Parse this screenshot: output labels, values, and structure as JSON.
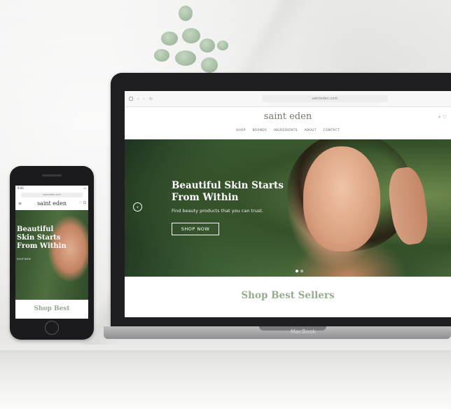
{
  "laptop": {
    "brand": "MacBook",
    "url": "sainteden.com",
    "site": {
      "logo": "saint eden",
      "nav": [
        "SHOP",
        "BRANDS",
        "INGREDIENTS",
        "ABOUT",
        "CONTACT"
      ],
      "hero": {
        "title_line1": "Beautiful Skin Starts",
        "title_line2": "From Within",
        "subtitle": "Find beauty products that you can trust.",
        "button": "SHOP NOW",
        "prev_arrow": "‹"
      },
      "section_title": "Shop Best Sellers"
    }
  },
  "phone": {
    "status_time": "9:41",
    "url": "sainteden.com",
    "site": {
      "menu_glyph": "≡",
      "logo": "saint eden",
      "icons": "♡ ⊡",
      "hero": {
        "title_line1": "Beautiful",
        "title_line2": "Skin Starts",
        "title_line3": "From Within",
        "subtitle": "SHOP NOW"
      },
      "section_title": "Shop Best"
    }
  },
  "colors": {
    "accent_green": "#97ab90",
    "logo_green": "#6e7a66"
  }
}
